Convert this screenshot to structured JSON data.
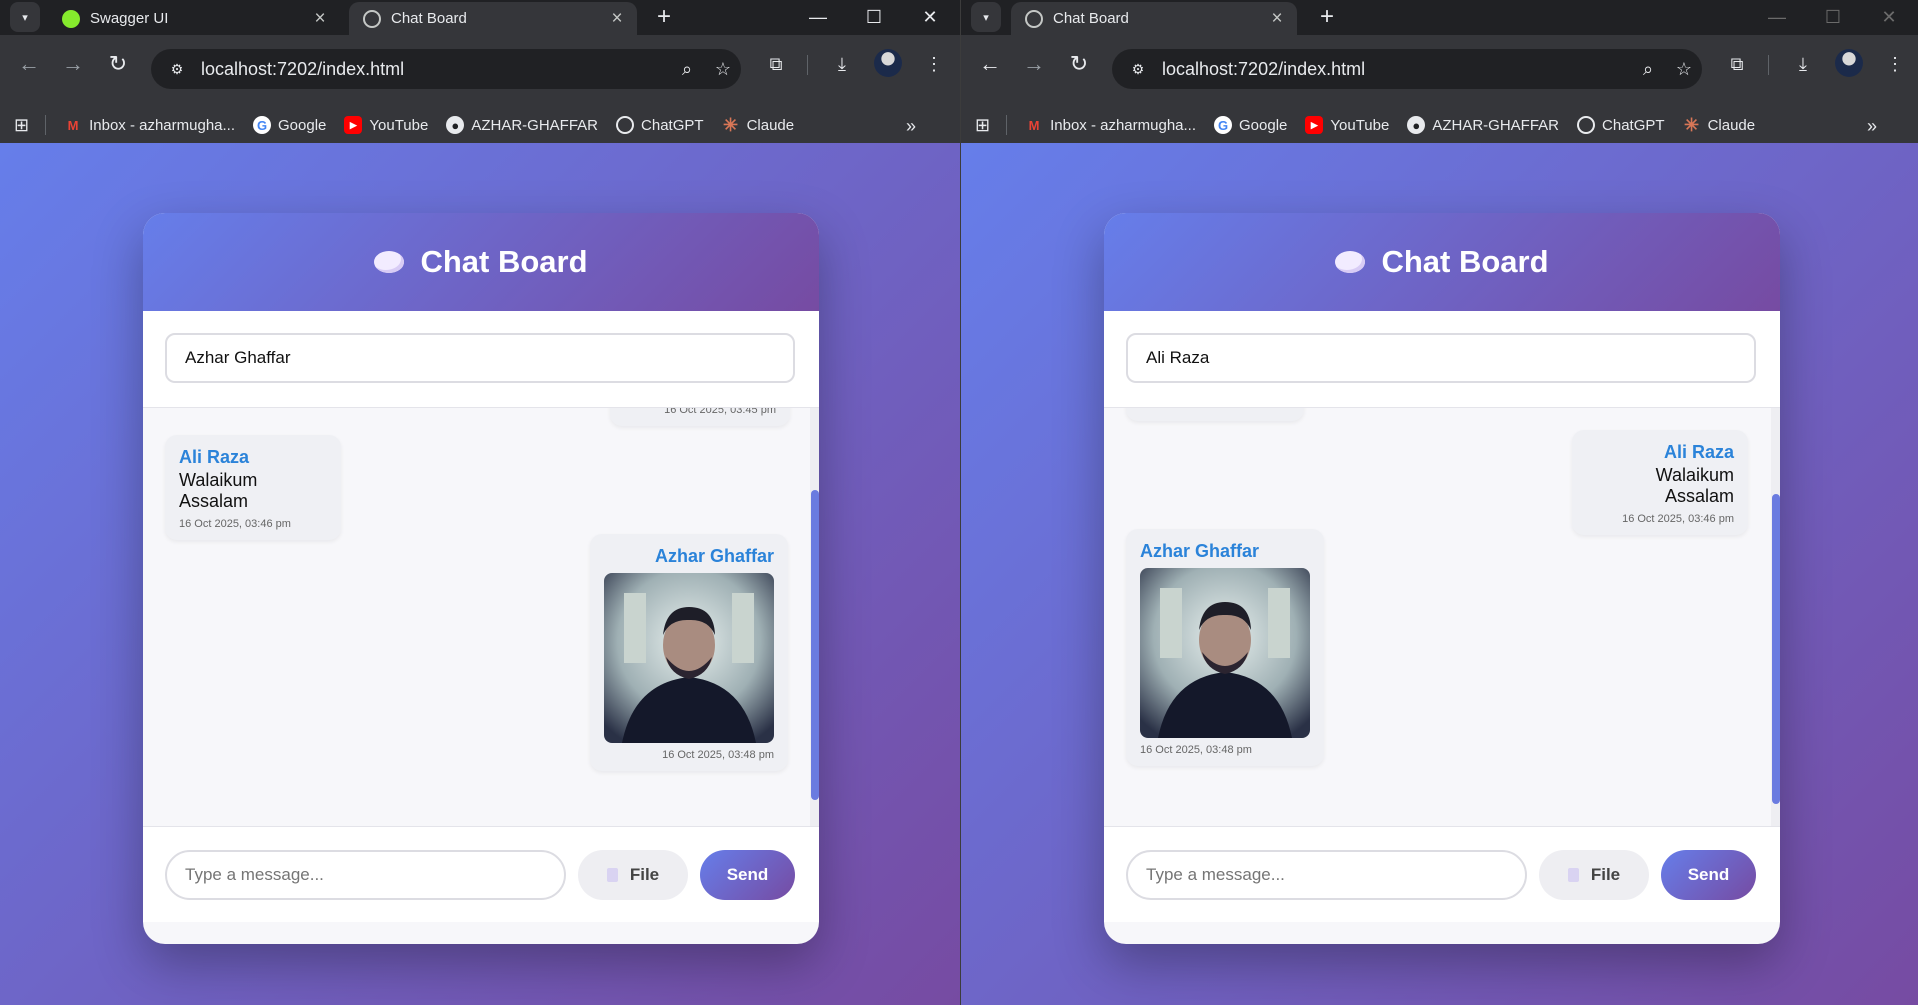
{
  "windows": [
    {
      "tabs": [
        {
          "label": "Swagger UI",
          "close": "×"
        },
        {
          "label": "Chat Board",
          "close": "×"
        }
      ],
      "address": "localhost:7202/index.html",
      "bookmarks": [
        "Inbox - azharmugha...",
        "Google",
        "YouTube",
        "AZHAR-GHAFFAR",
        "ChatGPT",
        "Claude"
      ],
      "chat": {
        "title": "Chat Board",
        "username": "Azhar Ghaffar",
        "partial_time": "16 Oct 2025, 03:45 pm",
        "messages": [
          {
            "sender": "Ali Raza",
            "text": "Walaikum Assalam",
            "time": "16 Oct 2025, 03:46 pm"
          },
          {
            "sender": "Azhar Ghaffar",
            "time": "16 Oct 2025, 03:48 pm",
            "image": "profile-photo"
          }
        ],
        "message_placeholder": "Type a message...",
        "file_label": "File",
        "send_label": "Send"
      }
    },
    {
      "tabs": [
        {
          "label": "Chat Board",
          "close": "×"
        }
      ],
      "address": "localhost:7202/index.html",
      "bookmarks": [
        "Inbox - azharmugha...",
        "Google",
        "YouTube",
        "AZHAR-GHAFFAR",
        "ChatGPT",
        "Claude"
      ],
      "chat": {
        "title": "Chat Board",
        "username": "Ali Raza",
        "messages": [
          {
            "sender": "Ali Raza",
            "text": "Walaikum Assalam",
            "time": "16 Oct 2025, 03:46 pm"
          },
          {
            "sender": "Azhar Ghaffar",
            "time": "16 Oct 2025, 03:48 pm",
            "image": "profile-photo"
          }
        ],
        "message_placeholder": "Type a message...",
        "file_label": "File",
        "send_label": "Send"
      }
    }
  ],
  "colors": {
    "gradient_start": "#667eea",
    "gradient_end": "#764ba2",
    "sender": "#2b83d9"
  },
  "icons": {
    "bookmark_icons": [
      "gmail-icon",
      "google-icon",
      "youtube-icon",
      "github-icon",
      "chatgpt-icon",
      "claude-icon"
    ]
  }
}
